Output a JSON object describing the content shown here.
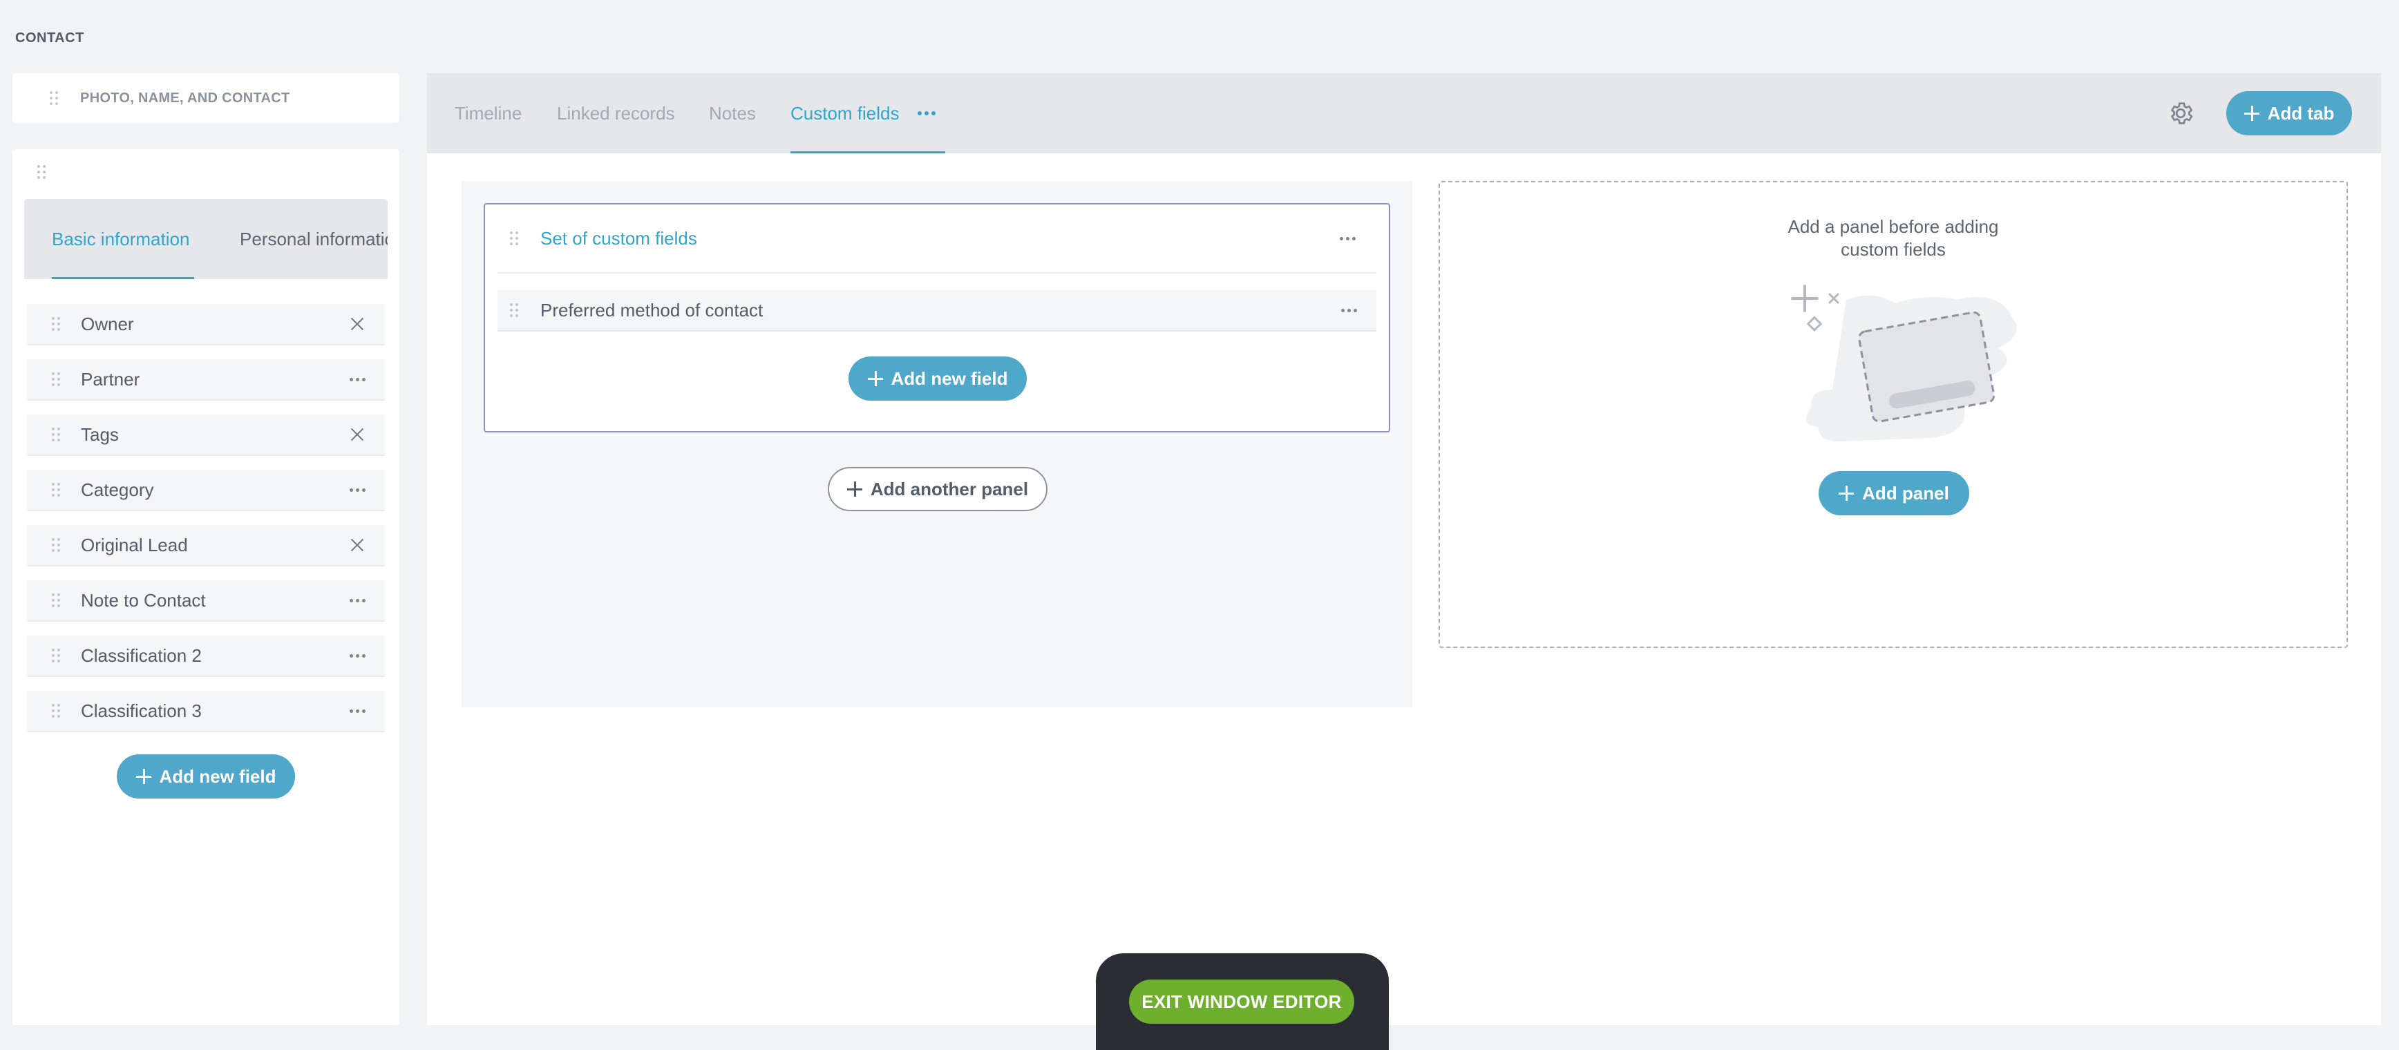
{
  "page_label": "CONTACT",
  "left": {
    "photo_card_label": "PHOTO, NAME, AND CONTACT",
    "subtabs": [
      "Basic information",
      "Personal information"
    ],
    "fields": [
      {
        "label": "Owner",
        "action": "remove"
      },
      {
        "label": "Partner",
        "action": "more"
      },
      {
        "label": "Tags",
        "action": "remove"
      },
      {
        "label": "Category",
        "action": "more"
      },
      {
        "label": "Original Lead",
        "action": "remove"
      },
      {
        "label": "Note to Contact",
        "action": "more"
      },
      {
        "label": "Classification 2",
        "action": "more"
      },
      {
        "label": "Classification 3",
        "action": "more"
      }
    ],
    "add_field_label": "Add new field"
  },
  "main": {
    "tabs": [
      "Timeline",
      "Linked records",
      "Notes",
      "Custom fields"
    ],
    "active_tab": "Custom fields",
    "add_tab_label": "Add tab",
    "panel": {
      "title": "Set of custom fields",
      "field": "Preferred method of contact",
      "add_field_label": "Add new field"
    },
    "add_another_panel_label": "Add another panel",
    "empty_hint_line1": "Add a panel before adding",
    "empty_hint_line2": "custom fields",
    "add_panel_label": "Add panel"
  },
  "exit_label": "EXIT WINDOW EDITOR",
  "colors": {
    "accent": "#2fa6c9",
    "primary_button": "#4fa7c9",
    "exit_button": "#6eaf2e",
    "panel_border": "#8b93c3"
  }
}
